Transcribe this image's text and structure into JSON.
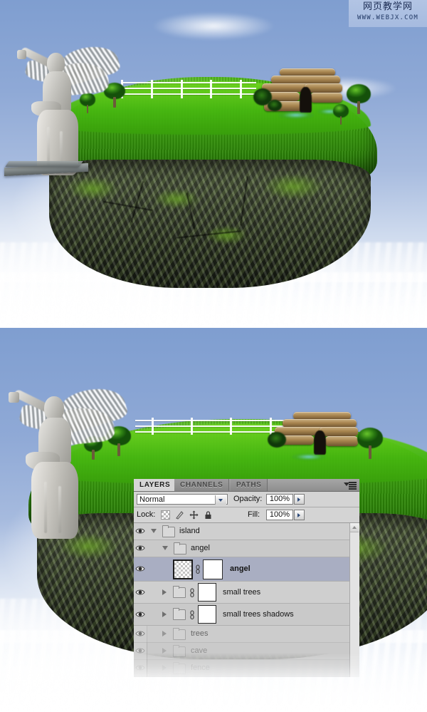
{
  "watermark": {
    "cn": "网页教学网",
    "en": "WWW.WEBJX.COM"
  },
  "scenes": [
    {
      "name": "top-composite-preview"
    },
    {
      "name": "bottom-composite-with-layers-panel"
    }
  ],
  "panel": {
    "tabs": [
      {
        "label": "LAYERS",
        "active": true
      },
      {
        "label": "CHANNELS",
        "active": false
      },
      {
        "label": "PATHS",
        "active": false
      }
    ],
    "menu_icon": "panel-menu-icon",
    "blend_mode": "Normal",
    "opacity_label": "Opacity:",
    "opacity_value": "100%",
    "lock_label": "Lock:",
    "lock_icons": [
      "lock-transparent-pixels-icon",
      "lock-image-pixels-icon",
      "lock-position-icon",
      "lock-all-icon"
    ],
    "fill_label": "Fill:",
    "fill_value": "100%",
    "layers": [
      {
        "name": "island",
        "type": "group",
        "expanded": true,
        "indent": 0,
        "visible": true,
        "selected": false,
        "thumb": "none",
        "mask": false,
        "link": false,
        "fade": "none"
      },
      {
        "name": "angel",
        "type": "group",
        "expanded": true,
        "indent": 1,
        "visible": true,
        "selected": false,
        "thumb": "none",
        "mask": false,
        "link": false,
        "fade": "none"
      },
      {
        "name": "angel",
        "type": "layer",
        "expanded": false,
        "indent": 2,
        "visible": true,
        "selected": true,
        "thumb": "checker",
        "mask": true,
        "link": true,
        "fade": "none"
      },
      {
        "name": "small trees",
        "type": "group",
        "expanded": false,
        "indent": 1,
        "visible": true,
        "selected": false,
        "thumb": "none",
        "mask": true,
        "link": true,
        "fade": "none"
      },
      {
        "name": "small trees shadows",
        "type": "group",
        "expanded": false,
        "indent": 1,
        "visible": true,
        "selected": false,
        "thumb": "none",
        "mask": true,
        "link": true,
        "fade": "none"
      },
      {
        "name": "trees",
        "type": "group",
        "expanded": false,
        "indent": 1,
        "visible": true,
        "selected": false,
        "thumb": "none",
        "mask": false,
        "link": false,
        "fade": "light"
      },
      {
        "name": "cave",
        "type": "group",
        "expanded": false,
        "indent": 1,
        "visible": true,
        "selected": false,
        "thumb": "none",
        "mask": false,
        "link": false,
        "fade": "medium"
      },
      {
        "name": "fence",
        "type": "group",
        "expanded": false,
        "indent": 1,
        "visible": true,
        "selected": false,
        "thumb": "none",
        "mask": false,
        "link": false,
        "fade": "heavy"
      }
    ],
    "scrollbar": {
      "up_arrow": "scroll-up-arrow-icon"
    }
  },
  "colors": {
    "sky_top": "#7f9ed0",
    "sky_bottom": "#ffffff",
    "grass": "#3fae0c",
    "rock": "#2c3324",
    "cave_rock": "#a8854f",
    "statue": "#c3c2bd",
    "panel_bg": "#d4d4d4",
    "panel_row": "#cfcfcf",
    "panel_selected_row": "#a9aec2",
    "tab_active": "#d6d6d6"
  }
}
